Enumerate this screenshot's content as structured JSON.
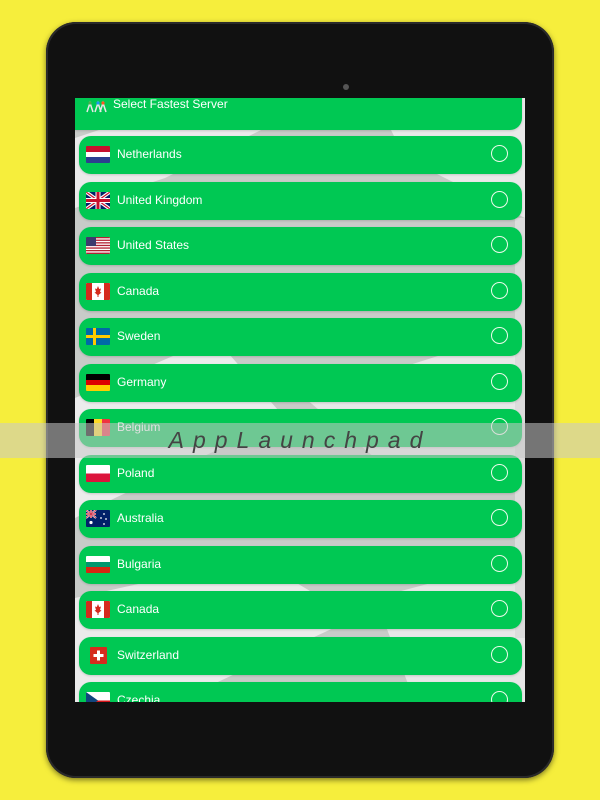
{
  "watermark": "AppLaunchpad",
  "fastest": {
    "label": "Select Fastest Server",
    "icon": "multi-server-icon"
  },
  "servers": [
    {
      "name": "Netherlands",
      "flag": "netherlands-flag-icon"
    },
    {
      "name": "United Kingdom",
      "flag": "uk-flag-icon"
    },
    {
      "name": "United States",
      "flag": "us-flag-icon"
    },
    {
      "name": "Canada",
      "flag": "canada-flag-icon"
    },
    {
      "name": "Sweden",
      "flag": "sweden-flag-icon"
    },
    {
      "name": "Germany",
      "flag": "germany-flag-icon"
    },
    {
      "name": "Belgium",
      "flag": "belgium-flag-icon"
    },
    {
      "name": "Poland",
      "flag": "poland-flag-icon"
    },
    {
      "name": "Australia",
      "flag": "australia-flag-icon"
    },
    {
      "name": "Bulgaria",
      "flag": "bulgaria-flag-icon"
    },
    {
      "name": "Canada",
      "flag": "canada-flag-icon"
    },
    {
      "name": "Switzerland",
      "flag": "switzerland-flag-icon"
    },
    {
      "name": "Czechia",
      "flag": "czechia-flag-icon"
    }
  ],
  "colors": {
    "background": "#f6ee3c",
    "row": "#00c853",
    "device": "#111111"
  }
}
